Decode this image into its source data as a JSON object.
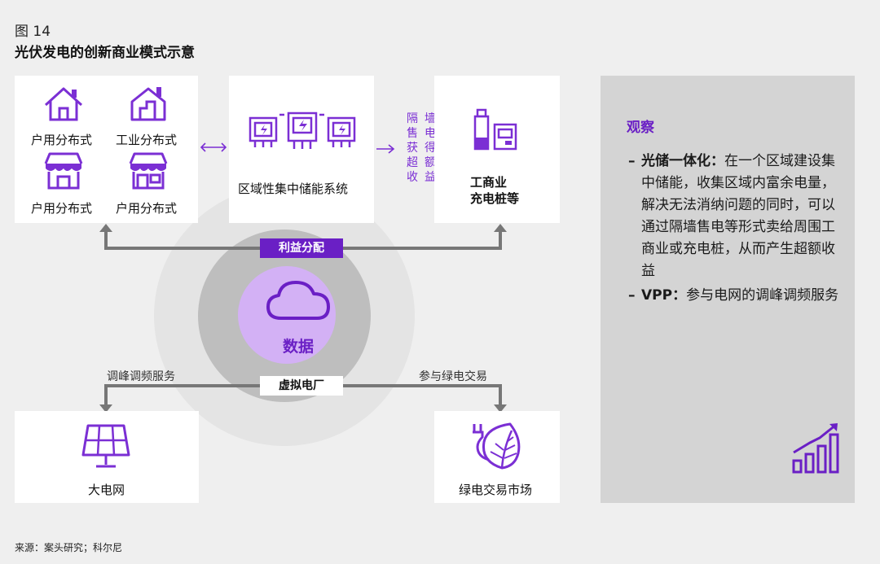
{
  "figure": {
    "number": "图 14",
    "title": "光伏发电的创新商业模式示意"
  },
  "left_box": {
    "items": [
      "户用分布式",
      "工业分布式",
      "户用分布式",
      "户用分布式"
    ]
  },
  "middle_box": {
    "label": "区域性集中储能系统"
  },
  "right_box": {
    "label_line1": "工商业",
    "label_line2": "充电桩等"
  },
  "side_note": [
    "隔",
    "墙",
    "售",
    "电",
    "获",
    "得",
    "超",
    "额",
    "收",
    "益"
  ],
  "center": {
    "profit_tag": "利益分配",
    "data_label": "数据",
    "vpp_tag": "虚拟电厂",
    "left_flow": "调峰调频服务",
    "right_flow": "参与绿电交易"
  },
  "bottom_left_box": {
    "label": "大电网"
  },
  "bottom_right_box": {
    "label": "绿电交易市场"
  },
  "observations": {
    "title": "观察",
    "items": [
      {
        "bold": "光储一体化：",
        "text": "在一个区域建设集中储能，收集区域内富余电量，解决无法消纳问题的同时，可以通过隔墙售电等形式卖给周围工商业或充电桩，从而产生超额收益"
      },
      {
        "bold": "VPP：",
        "text": "参与电网的调峰调频服务"
      }
    ]
  },
  "source": "来源：案头研究；科尔尼",
  "colors": {
    "purple": "#7b2fd4",
    "tag_purple": "#6a1fc5",
    "panel": "#d4d4d4",
    "arrow": "#777777"
  }
}
